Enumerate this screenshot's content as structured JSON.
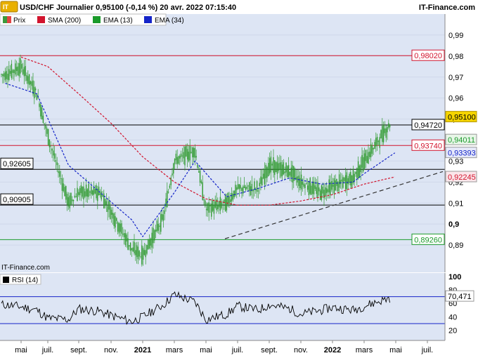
{
  "header": {
    "logo_text": "IT-Finance.com",
    "title": "USD/CHF Journalier 0,95100 (-0,14 %) 20 avr. 2022 07:15:40",
    "site": "IT-Finance.com"
  },
  "legend": [
    {
      "label": "Prix",
      "color": "#3c9a3c",
      "icon": "price-swatch"
    },
    {
      "label": "SMA (200)",
      "color": "#d2142d",
      "icon": "square-swatch"
    },
    {
      "label": "EMA (13)",
      "color": "#1a9a2a",
      "icon": "square-swatch"
    },
    {
      "label": "EMA (34)",
      "color": "#1424c8",
      "icon": "square-swatch"
    }
  ],
  "watermark": "IT-Finance.com",
  "rsi_legend": "RSI (14)",
  "colors": {
    "panel_bg": "#dde5f4",
    "candle": "#2e9a2e",
    "sma200": "#d2142d",
    "ema34": "#1424c8",
    "price_highlight": "#f6d500"
  },
  "chart_data": [
    {
      "type": "line",
      "title": "USD/CHF Journalier",
      "ylim": [
        0.877,
        1.0
      ],
      "y_ticks": [
        "0,99",
        "0,98",
        "0,97",
        "0,96",
        "0,95",
        "0,94",
        "0,93",
        "0,92",
        "0,91",
        "0,9",
        "0,89"
      ],
      "x_labels": [
        "mai",
        "juil.",
        "sept.",
        "nov.",
        "2021",
        "mars",
        "mai",
        "juil.",
        "sept.",
        "nov.",
        "2022",
        "mars",
        "mai",
        "juil."
      ],
      "x_label_bold": [
        "2021",
        "2022",
        "0,9"
      ],
      "horizontal_levels": [
        {
          "value": 0.9802,
          "label": "0,98020",
          "color": "#d2142d",
          "side": "right"
        },
        {
          "value": 0.9472,
          "label": "0,94720",
          "color": "#000000",
          "side": "right"
        },
        {
          "value": 0.9374,
          "label": "0,93740",
          "color": "#d2142d",
          "side": "right"
        },
        {
          "value": 0.92605,
          "label": "0,92605",
          "color": "#000000",
          "side": "left"
        },
        {
          "value": 0.90905,
          "label": "0,90905",
          "color": "#000000",
          "side": "left"
        },
        {
          "value": 0.8926,
          "label": "0,89260",
          "color": "#1a9a2a",
          "side": "right"
        }
      ],
      "value_tags": [
        {
          "value": 0.951,
          "label": "0,95100",
          "kind": "price"
        },
        {
          "value": 0.94011,
          "label": "0,94011",
          "kind": "ema13"
        },
        {
          "value": 0.93393,
          "label": "0,93393",
          "kind": "ema34"
        },
        {
          "value": 0.92245,
          "label": "0,92245",
          "kind": "sma200"
        }
      ],
      "trendline": {
        "from": [
          "2021-06",
          0.893
        ],
        "to": [
          "2022-04-20",
          0.925
        ]
      },
      "series": [
        {
          "name": "Prix",
          "kind": "candles",
          "x": [
            "2020-04",
            "2020-05",
            "2020-06",
            "2020-07",
            "2020-08",
            "2020-09",
            "2020-10",
            "2020-11",
            "2020-12",
            "2021-01",
            "2021-02",
            "2021-03",
            "2021-04",
            "2021-05",
            "2021-06",
            "2021-07",
            "2021-08",
            "2021-09",
            "2021-10",
            "2021-11",
            "2021-12",
            "2022-01",
            "2022-02",
            "2022-03",
            "2022-04-20"
          ],
          "values": [
            0.971,
            0.975,
            0.962,
            0.942,
            0.91,
            0.915,
            0.915,
            0.906,
            0.888,
            0.885,
            0.903,
            0.93,
            0.935,
            0.907,
            0.91,
            0.917,
            0.917,
            0.928,
            0.925,
            0.92,
            0.915,
            0.918,
            0.922,
            0.93,
            0.951
          ]
        },
        {
          "name": "SMA (200)",
          "kind": "dashed",
          "x": [
            "2020-05",
            "2020-07",
            "2020-09",
            "2020-11",
            "2021-01",
            "2021-03",
            "2021-05",
            "2021-07",
            "2021-09",
            "2021-11",
            "2022-01",
            "2022-03",
            "2022-04-20"
          ],
          "values": [
            0.9795,
            0.975,
            0.962,
            0.948,
            0.932,
            0.92,
            0.912,
            0.909,
            0.909,
            0.911,
            0.914,
            0.919,
            0.92245
          ]
        },
        {
          "name": "EMA (34)",
          "kind": "dashed",
          "x": [
            "2020-04",
            "2020-06",
            "2020-08",
            "2020-10",
            "2020-12",
            "2021-01",
            "2021-03",
            "2021-04",
            "2021-06",
            "2021-08",
            "2021-10",
            "2021-12",
            "2022-02",
            "2022-03",
            "2022-04-20"
          ],
          "values": [
            0.967,
            0.962,
            0.928,
            0.915,
            0.902,
            0.894,
            0.915,
            0.93,
            0.913,
            0.917,
            0.922,
            0.919,
            0.92,
            0.924,
            0.93393
          ]
        }
      ]
    },
    {
      "type": "line",
      "title": "RSI (14)",
      "ylim": [
        5,
        105
      ],
      "y_ticks": [
        "100",
        "80",
        "60",
        "40",
        "20"
      ],
      "levels": [
        70,
        30
      ],
      "value_tag": {
        "value": 70.471,
        "label": "70,471"
      },
      "series": [
        {
          "name": "RSI (14)",
          "x": [
            "2020-04",
            "2020-05",
            "2020-06",
            "2020-07",
            "2020-08",
            "2020-09",
            "2020-10",
            "2020-11",
            "2020-12",
            "2021-01",
            "2021-02",
            "2021-03",
            "2021-04",
            "2021-05",
            "2021-06",
            "2021-07",
            "2021-08",
            "2021-09",
            "2021-10",
            "2021-11",
            "2021-12",
            "2022-01",
            "2022-02",
            "2022-03",
            "2022-04-20"
          ],
          "values": [
            58,
            55,
            50,
            38,
            36,
            52,
            48,
            42,
            33,
            40,
            58,
            73,
            62,
            36,
            44,
            56,
            50,
            58,
            52,
            44,
            50,
            54,
            50,
            56,
            70.471
          ]
        }
      ]
    }
  ]
}
